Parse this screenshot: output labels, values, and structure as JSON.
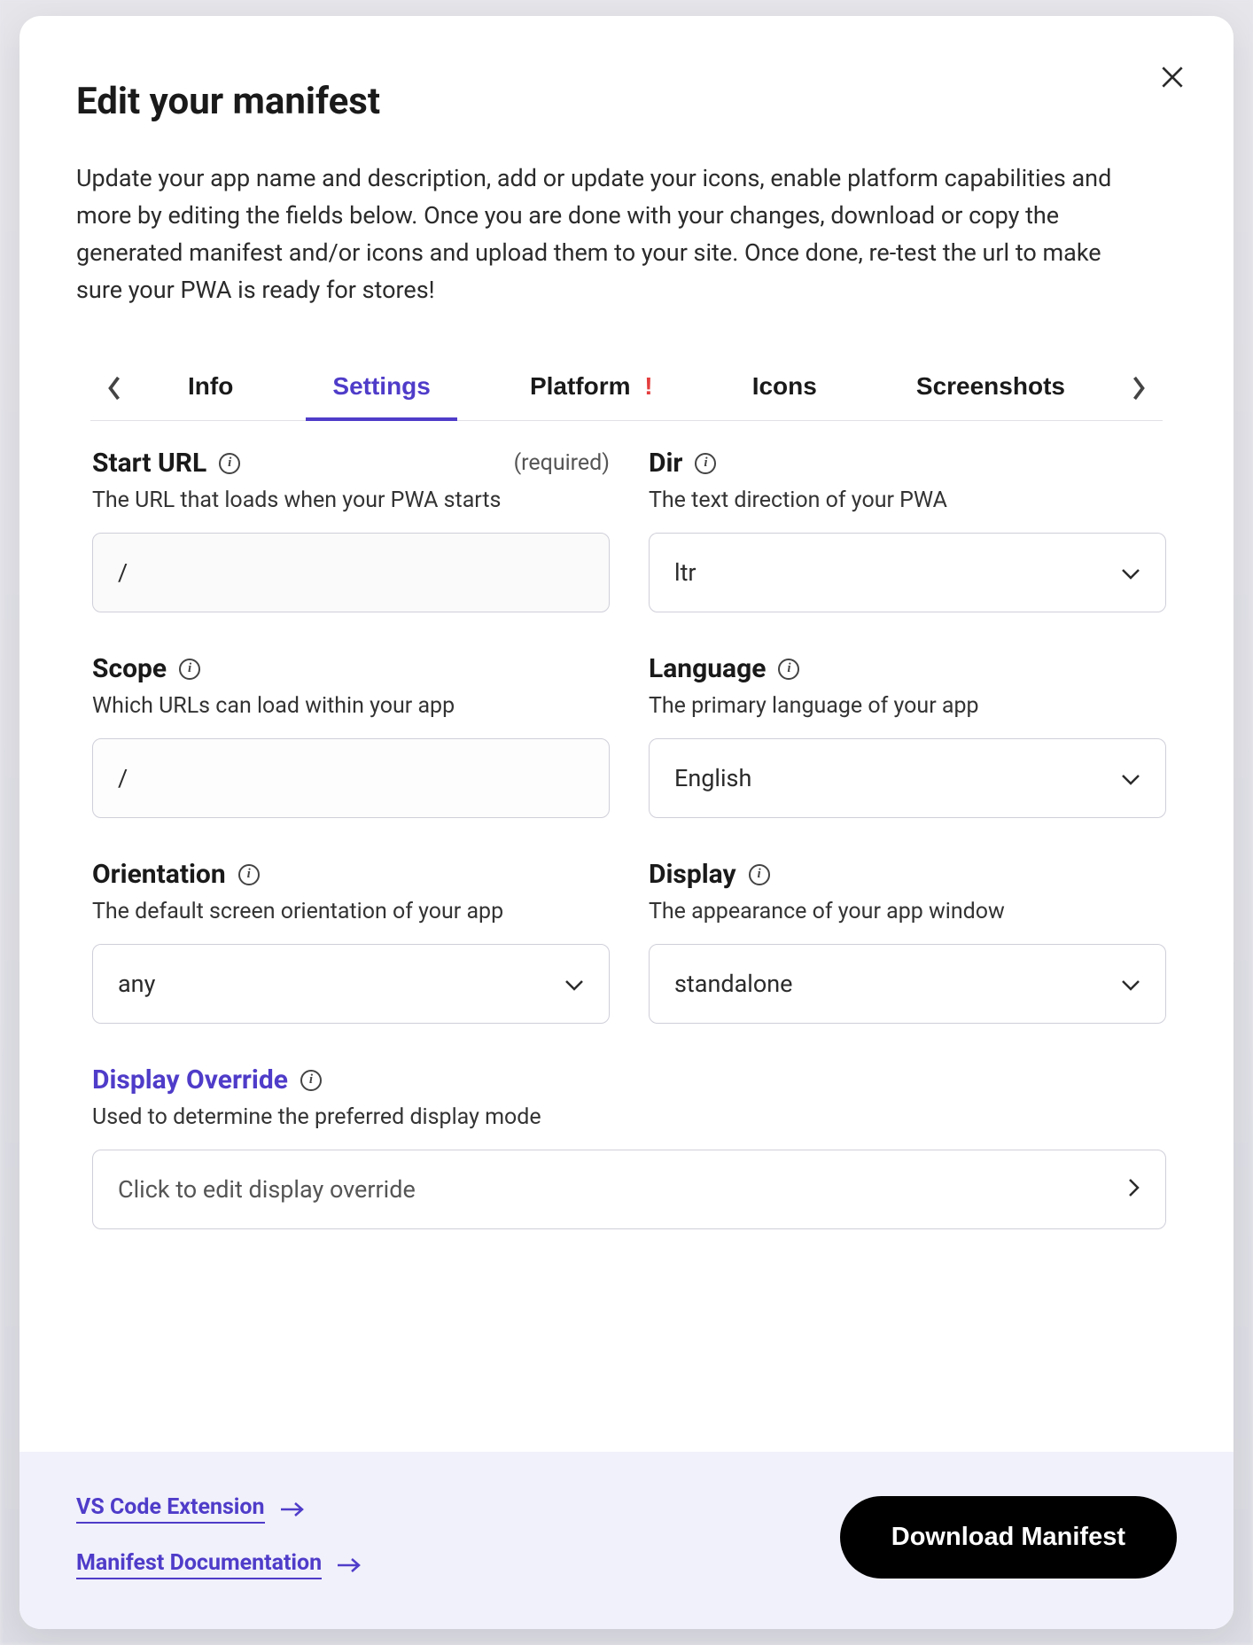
{
  "modal": {
    "title": "Edit your manifest",
    "description": "Update your app name and description, add or update your icons, enable platform capabilities and more by editing the fields below. Once you are done with your changes, download or copy the generated manifest and/or icons and upload them to your site. Once done, re-test the url to make sure your PWA is ready for stores!"
  },
  "tabs": {
    "info": "Info",
    "settings": "Settings",
    "platform": "Platform",
    "platform_warn": "!",
    "icons": "Icons",
    "screenshots": "Screenshots"
  },
  "fields": {
    "start_url": {
      "label": "Start URL",
      "required": "(required)",
      "sub": "The URL that loads when your PWA starts",
      "value": "/"
    },
    "dir": {
      "label": "Dir",
      "sub": "The text direction of your PWA",
      "value": "ltr"
    },
    "scope": {
      "label": "Scope",
      "sub": "Which URLs can load within your app",
      "value": "/"
    },
    "language": {
      "label": "Language",
      "sub": "The primary language of your app",
      "value": "English"
    },
    "orientation": {
      "label": "Orientation",
      "sub": "The default screen orientation of your app",
      "value": "any"
    },
    "display": {
      "label": "Display",
      "sub": "The appearance of your app window",
      "value": "standalone"
    },
    "display_override": {
      "label": "Display Override",
      "sub": "Used to determine the preferred display mode",
      "value": "Click to edit display override"
    }
  },
  "footer": {
    "vscode": "VS Code Extension",
    "docs": "Manifest Documentation",
    "download": "Download Manifest"
  }
}
